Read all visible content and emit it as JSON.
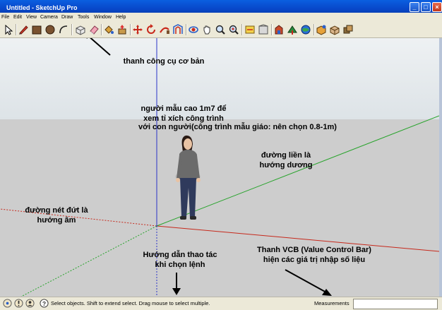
{
  "window": {
    "title": "Untitled - SketchUp Pro",
    "minimize_glyph": "_",
    "maximize_glyph": "□",
    "close_glyph": "×"
  },
  "menubar": {
    "items": [
      "File",
      "Edit",
      "View",
      "Camera",
      "Draw",
      "Tools",
      "Window",
      "Help"
    ]
  },
  "toolbar": {
    "icons": [
      "select-icon",
      "pencil-icon",
      "rectangle-icon",
      "circle-icon",
      "arc-icon",
      "make-component-icon",
      "eraser-icon",
      "paint-bucket-icon",
      "push-pull-icon",
      "move-icon",
      "rotate-icon",
      "follow-me-icon",
      "offset-icon",
      "orbit-icon",
      "pan-icon",
      "zoom-icon",
      "zoom-extents-icon",
      "section-plane-icon",
      "3d-warehouse-icon",
      "google-earth-icon",
      "share-model-icon",
      "get-models-icon",
      "extension-warehouse-icon",
      "layout-icon"
    ]
  },
  "viewport": {
    "sky_color": "#dfe6ec",
    "ground_color": "#cfcfcf",
    "axis_colors": {
      "red": "#c6281b",
      "green": "#27a32b",
      "blue": "#2a34c8"
    }
  },
  "annotations": {
    "toolbar_note": "thanh công cụ cơ bản",
    "person_note_1": "người mẫu cao 1m7 để",
    "person_note_2": "xem tỉ xích công trình",
    "person_note_3": "với con người(công trình mẫu giáo: nên chọn 0.8-1m)",
    "solid_line_1": "đường liền là",
    "solid_line_2": "hướng dương",
    "dashed_line_1": "đường nét đứt là",
    "dashed_line_2": "hướng âm",
    "hint_1": "Hướng dẫn thao tác",
    "hint_2": "khi chọn lệnh",
    "vcb_1": "Thanh VCB (Value Control Bar)",
    "vcb_2": "hiện các giá trị nhập số liệu"
  },
  "statusbar": {
    "icons": [
      "geo-location-icon",
      "credits-icon",
      "user-icon",
      "help-icon"
    ],
    "message": "Select objects. Shift to extend select. Drag mouse to select multiple.",
    "measurements_label": "Measurements",
    "measurements_value": ""
  }
}
